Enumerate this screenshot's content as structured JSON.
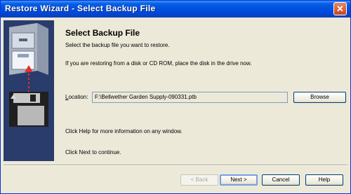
{
  "window": {
    "title": "Restore Wizard - Select Backup File"
  },
  "page": {
    "heading": "Select Backup File",
    "instruction": "Select the backup file you want to restore.",
    "disk_note": "If you are restoring from a disk or CD ROM, place the disk in the drive now.",
    "help_note": "Click Help for more information on any window.",
    "next_note": "Click Next to continue."
  },
  "location": {
    "label_key": "L",
    "label_rest": "ocation:",
    "value": "F:\\Bellwether Garden Supply-090331.ptb",
    "browse_label": "Browse"
  },
  "footer": {
    "back_label": "< Back",
    "next_label": "Next >",
    "cancel_label": "Cancel",
    "help_label": "Help"
  },
  "colors": {
    "titlebar": "#0050e0",
    "sidepanel": "#293c6b",
    "dialog_bg": "#ece9d8",
    "arrow": "#e03030"
  },
  "icons": [
    "close-icon",
    "filing-cabinet-icon",
    "red-arrow-icon",
    "floppy-disk-icon"
  ]
}
